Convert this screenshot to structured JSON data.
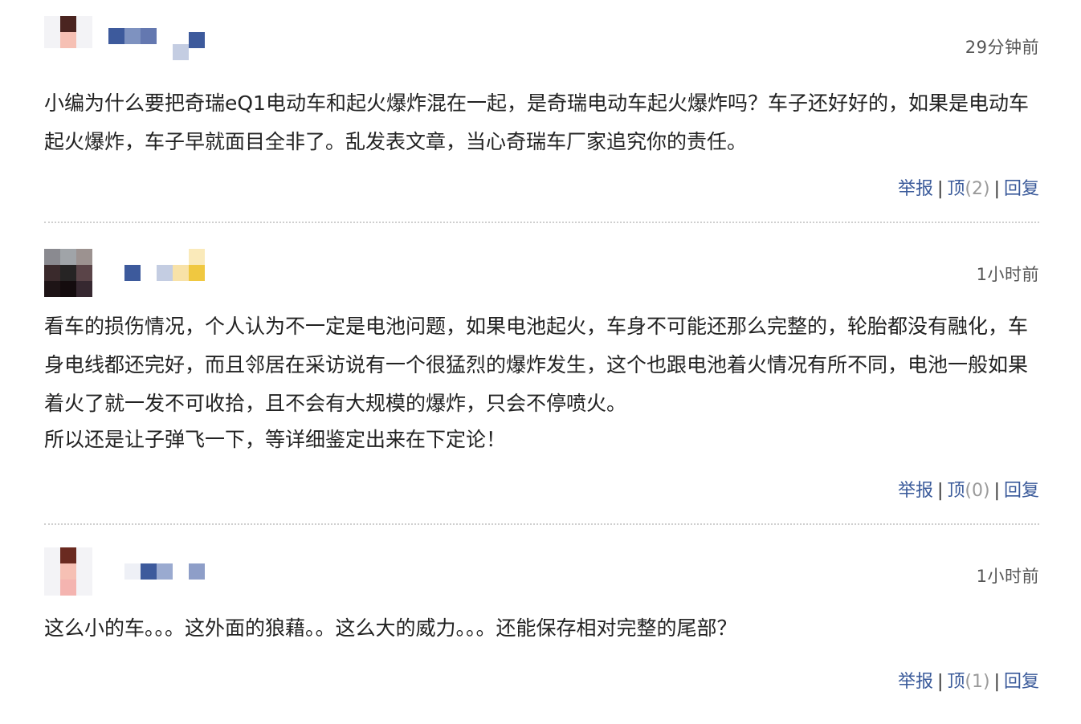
{
  "comments": [
    {
      "time": "29分钟前",
      "body": [
        "小编为什么要把奇瑞eQ1电动车和起火爆炸混在一起，是奇瑞电动车起火爆炸吗？车子还好好的，如果是电动车起火爆炸，车子早就面目全非了。乱发表文章，当心奇瑞车厂家追究你的责任。"
      ],
      "report_label": "举报",
      "top_label": "顶",
      "top_count": "(2)",
      "reply_label": "回复"
    },
    {
      "time": "1小时前",
      "body": [
        "看车的损伤情况，个人认为不一定是电池问题，如果电池起火，车身不可能还那么完整的，轮胎都没有融化，车身电线都还完好，而且邻居在采访说有一个很猛烈的爆炸发生，这个也跟电池着火情况有所不同，电池一般如果着火了就一发不可收拾，且不会有大规模的爆炸，只会不停喷火。",
        "所以还是让子弹飞一下，等详细鉴定出来在下定论！"
      ],
      "report_label": "举报",
      "top_label": "顶",
      "top_count": "(0)",
      "reply_label": "回复"
    },
    {
      "time": "1小时前",
      "body": [
        "这么小的车。。。这外面的狼藉。。这么大的威力。。。还能保存相对完整的尾部？"
      ],
      "report_label": "举报",
      "top_label": "顶",
      "top_count": "(1)",
      "reply_label": "回复"
    }
  ],
  "separator": "|",
  "colors": {
    "link": "#3a5a9a",
    "count": "#9a9a9a",
    "time": "#555555",
    "divider": "#cfcfcf"
  }
}
